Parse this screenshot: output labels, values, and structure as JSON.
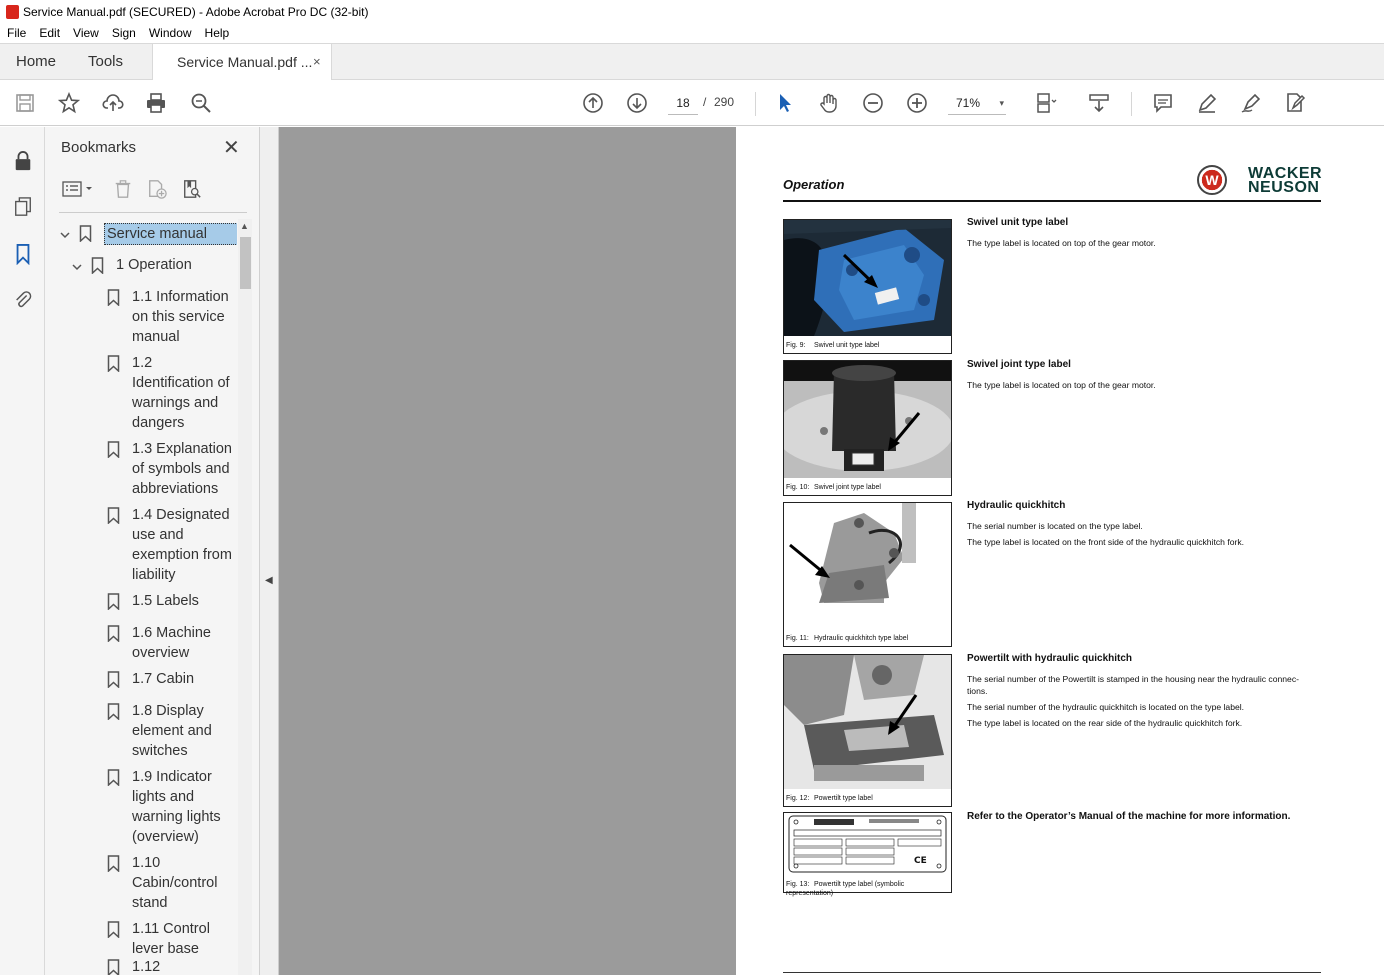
{
  "window": {
    "title": "Service Manual.pdf (SECURED) - Adobe Acrobat Pro DC (32-bit)"
  },
  "menu": [
    "File",
    "Edit",
    "View",
    "Sign",
    "Window",
    "Help"
  ],
  "tabs": {
    "home": "Home",
    "tools": "Tools",
    "document": "Service Manual.pdf ...",
    "close": "×"
  },
  "toolbar": {
    "current_page": "18",
    "separator": "/",
    "total_pages": "290",
    "zoom": "71%",
    "zoom_caret": "▾"
  },
  "bookmarks": {
    "title": "Bookmarks",
    "close": "✕",
    "items": [
      {
        "label": "Service manual",
        "level": 0,
        "expanded": true,
        "selected": true
      },
      {
        "label": "1 Operation",
        "level": 1,
        "expanded": true
      },
      {
        "label": "1.1 Information on this service manual",
        "level": 2
      },
      {
        "label": "1.2 Identification of warnings and dangers",
        "level": 2
      },
      {
        "label": "1.3 Explanation of symbols and abbreviations",
        "level": 2
      },
      {
        "label": "1.4 Designated use and exemption from liability",
        "level": 2
      },
      {
        "label": "1.5 Labels",
        "level": 2
      },
      {
        "label": "1.6 Machine overview",
        "level": 2
      },
      {
        "label": "1.7 Cabin",
        "level": 2
      },
      {
        "label": "1.8 Display element and switches",
        "level": 2
      },
      {
        "label": "1.9 Indicator lights and warning lights (overview)",
        "level": 2
      },
      {
        "label": "1.10 Cabin/control stand",
        "level": 2
      },
      {
        "label": "1.11 Control lever base",
        "level": 2
      },
      {
        "label": "1.12",
        "level": 2
      }
    ]
  },
  "page": {
    "heading": "Operation",
    "logo_text_1": "WACKER",
    "logo_text_2": "NEUSON",
    "sections": [
      {
        "title": "Swivel unit type label",
        "paragraphs": [
          "The type label is located on top of the gear motor."
        ],
        "fig_num": "Fig. 9:",
        "fig_caption": "Swivel unit type label"
      },
      {
        "title": "Swivel joint type label",
        "paragraphs": [
          "The type label is located on top of the gear motor."
        ],
        "fig_num": "Fig. 10:",
        "fig_caption": "Swivel joint type label"
      },
      {
        "title": "Hydraulic quickhitch",
        "paragraphs": [
          "The serial number is located on the type label.",
          "The type label is located on the front side of the hydraulic quickhitch fork."
        ],
        "fig_num": "Fig. 11:",
        "fig_caption": "Hydraulic quickhitch type label"
      },
      {
        "title": "Powertilt with hydraulic quickhitch",
        "paragraphs": [
          "The serial number of the Powertilt is stamped in the housing near the hydraulic connec-tions.",
          "The serial number of the hydraulic quickhitch is located on the type label.",
          "The type label is located on the rear side of the hydraulic quickhitch fork."
        ],
        "fig_num": "Fig. 12:",
        "fig_caption": "Powertilt type label"
      },
      {
        "title": "Refer to the Operator’s Manual of the machine for more information.",
        "paragraphs": [],
        "fig_num": "Fig. 13:",
        "fig_caption": "Powertilt type label (symbolic representation)"
      }
    ]
  },
  "colors": {
    "accent_blue": "#1a5fb4",
    "selected_bookmark": "#a6cbe8",
    "doc_background": "#9b9b9b",
    "logo_red": "#cc2a1d",
    "logo_green": "#0d3b36"
  }
}
